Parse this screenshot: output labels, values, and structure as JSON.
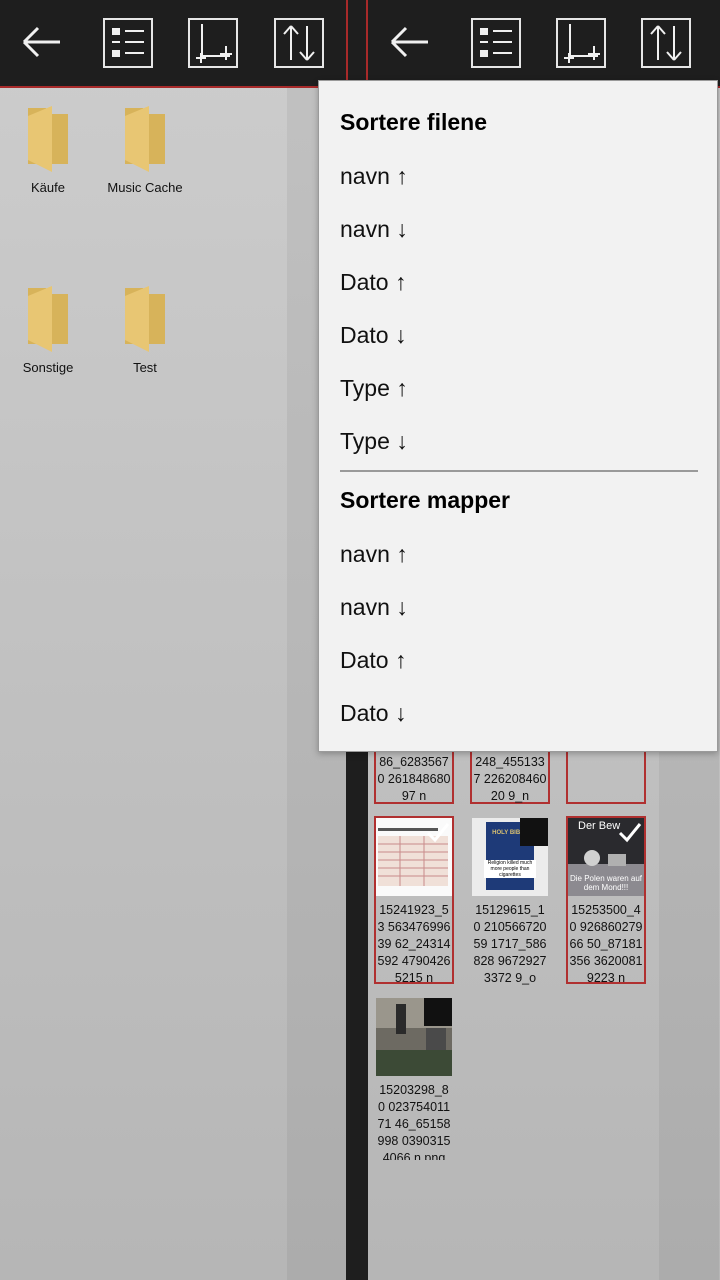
{
  "left_pane": {
    "folders": [
      {
        "name": "Käufe"
      },
      {
        "name": "Music Cache"
      },
      {
        "name": "Sonstige"
      },
      {
        "name": "Test"
      }
    ]
  },
  "toolbar": {
    "back_icon": "arrow-left-icon",
    "select_icon": "list-select-icon",
    "new_icon": "new-item-icon",
    "sort_icon": "sort-arrows-icon",
    "accent": "#a82a2a"
  },
  "right_pane": {
    "files": [
      {
        "caption": "86_62835670 26184868097 n"
      },
      {
        "caption": "248_4551337 22620846020 9_n"
      },
      {
        "caption": ""
      },
      {
        "caption": "15241923_53 56347699639 62_24314592 47904265215 n",
        "checked": true
      },
      {
        "caption": "15129615_10 21056672059 1717_586828 96729273372 9_o",
        "checked": false,
        "image_text": "HOLY BIBLE",
        "image_subtext": "Religion killed much more people than cigarettes"
      },
      {
        "caption": "15253500_40 92686027966 50_87181356 36200819223 n",
        "checked": true,
        "image_text": "Der Bew",
        "image_subtext": "Die Polen waren auf dem Mond!!!"
      },
      {
        "caption": "15203298_80 02375401171 46_65158998 03903154066 n.png",
        "checked": false
      }
    ]
  },
  "sort_menu": {
    "files_heading": "Sortere filene",
    "files_options": [
      "navn ↑",
      "navn ↓",
      "Dato ↑",
      "Dato ↓",
      "Type ↑",
      "Type ↓"
    ],
    "folders_heading": "Sortere mapper",
    "folders_options": [
      "navn ↑",
      "navn ↓",
      "Dato ↑",
      "Dato ↓"
    ]
  },
  "colors": {
    "folder": "#e8c673",
    "folder_dark": "#d7b35a",
    "selection_border": "#b03030",
    "menu_bg": "#f2f2f2"
  }
}
